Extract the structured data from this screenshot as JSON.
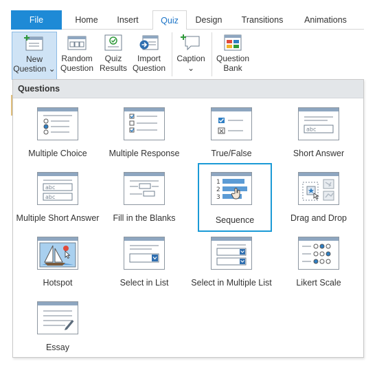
{
  "tabs": [
    {
      "label": "File"
    },
    {
      "label": "Home"
    },
    {
      "label": "Insert"
    },
    {
      "label": "Quiz"
    },
    {
      "label": "Design"
    },
    {
      "label": "Transitions"
    },
    {
      "label": "Animations"
    }
  ],
  "active_tab": "Quiz",
  "ribbon": {
    "new_question": {
      "line1": "New",
      "line2": "Question ⌄"
    },
    "random_question": {
      "line1": "Random",
      "line2": "Question"
    },
    "quiz_results": {
      "line1": "Quiz",
      "line2": "Results"
    },
    "import_question": {
      "line1": "Import",
      "line2": "Question"
    },
    "caption": {
      "line1": "Caption",
      "line2": "⌄"
    },
    "question_bank": {
      "line1": "Question",
      "line2": "Bank"
    }
  },
  "panel": {
    "header": "Questions",
    "items": [
      {
        "label": "Multiple Choice",
        "icon": "multiple-choice-icon"
      },
      {
        "label": "Multiple Response",
        "icon": "multiple-response-icon"
      },
      {
        "label": "True/False",
        "icon": "true-false-icon"
      },
      {
        "label": "Short Answer",
        "icon": "short-answer-icon"
      },
      {
        "label": "Multiple Short Answer",
        "icon": "multiple-short-answer-icon"
      },
      {
        "label": "Fill in the Blanks",
        "icon": "fill-in-the-blanks-icon"
      },
      {
        "label": "Sequence",
        "icon": "sequence-icon"
      },
      {
        "label": "Drag and Drop",
        "icon": "drag-and-drop-icon"
      },
      {
        "label": "Hotspot",
        "icon": "hotspot-icon"
      },
      {
        "label": "Select in List",
        "icon": "select-in-list-icon"
      },
      {
        "label": "Select in Multiple List",
        "icon": "select-in-multiple-list-icon"
      },
      {
        "label": "Likert Scale",
        "icon": "likert-scale-icon"
      },
      {
        "label": "Essay",
        "icon": "essay-icon"
      }
    ],
    "selected": "Sequence",
    "abc_text": "abc",
    "seq_numbers": [
      "1",
      "2",
      "3"
    ]
  },
  "colors": {
    "file_tab": "#1e8ad6",
    "active_tab_text": "#1a73c7",
    "selection_border": "#1a9ad6",
    "pressed_button": "#cfe3f5",
    "icon_accent": "#2f7fc4"
  }
}
